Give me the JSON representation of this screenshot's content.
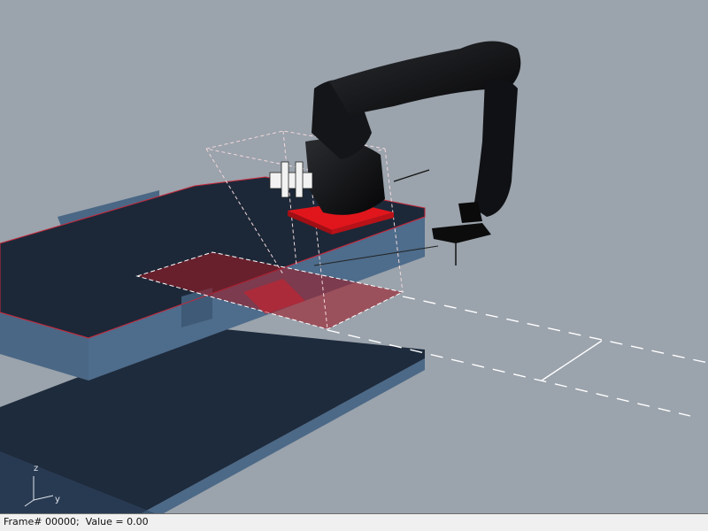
{
  "viewport": {
    "background": "#9ba3ac",
    "axis_labels": {
      "z": "z",
      "y": "y"
    }
  },
  "colors": {
    "table_top": "#1c2838",
    "table_side": "#4a6785",
    "table_edge": "#c8283c",
    "lower_table": "#1e2b3c",
    "lower_side": "#4c6987",
    "robot_body": "#111214",
    "robot_base": "#e0161c",
    "work_plane": "#9b1b26",
    "dashed_guide": "#ffffff"
  },
  "status_bar": {
    "text": "Frame# 00000;  Value = 0.00"
  }
}
